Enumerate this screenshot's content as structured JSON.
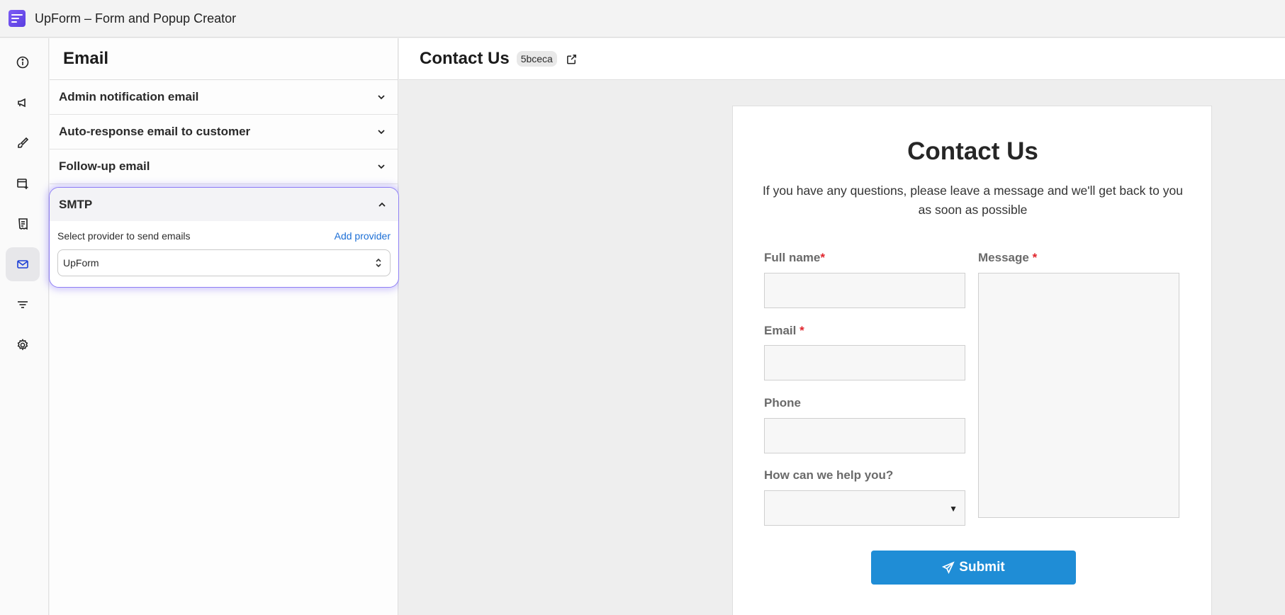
{
  "app": {
    "title": "UpForm – Form and Popup Creator",
    "logo_icon": "upform-logo-icon"
  },
  "rail": {
    "items": [
      {
        "name": "info",
        "icon": "info-icon"
      },
      {
        "name": "announcement",
        "icon": "megaphone-icon"
      },
      {
        "name": "design",
        "icon": "brush-icon"
      },
      {
        "name": "add-popup",
        "icon": "add-window-icon"
      },
      {
        "name": "entries",
        "icon": "receipt-icon"
      },
      {
        "name": "email",
        "icon": "mail-icon",
        "active": true
      },
      {
        "name": "filters",
        "icon": "filter-icon"
      },
      {
        "name": "settings",
        "icon": "gear-icon"
      }
    ]
  },
  "panel": {
    "title": "Email",
    "sections": [
      {
        "label": "Admin notification email",
        "expanded": false
      },
      {
        "label": "Auto-response email to customer",
        "expanded": false
      },
      {
        "label": "Follow-up email",
        "expanded": false
      }
    ],
    "smtp": {
      "label": "SMTP",
      "expanded": true,
      "select_label": "Select provider to send emails",
      "add_provider_label": "Add provider",
      "provider_value": "UpForm"
    }
  },
  "header": {
    "form_title": "Contact Us",
    "form_id": "5bceca"
  },
  "form_preview": {
    "title": "Contact Us",
    "description": "If you have any questions, please leave a message and we'll get back to you as soon as possible",
    "fields": {
      "full_name": {
        "label": "Full name",
        "required_mark": "*"
      },
      "email": {
        "label": "Email",
        "required_mark": "*"
      },
      "phone": {
        "label": "Phone"
      },
      "help": {
        "label": "How can we help you?",
        "arrow": "▼"
      },
      "message": {
        "label": "Message",
        "required_mark": "*"
      }
    },
    "submit_label": "Submit"
  },
  "colors": {
    "accent": "#8f7ff5",
    "link": "#1c6fd6",
    "submit": "#1f8dd6",
    "required": "#e0242c"
  }
}
